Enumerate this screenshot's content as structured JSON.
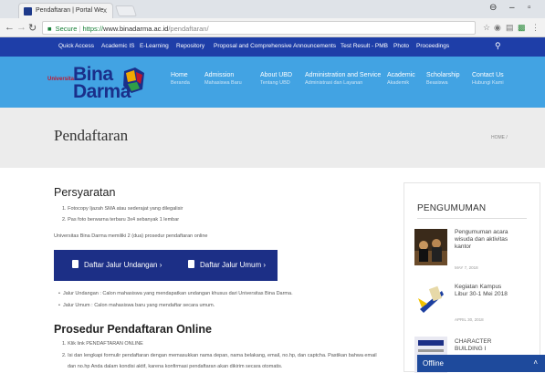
{
  "browser": {
    "tab_title": "Pendaftaran | Portal We",
    "tab_close": "x",
    "url_secure": "Secure",
    "url_protocol": "https://",
    "url_host": "www.binadarma.ac.id",
    "url_path": "/pendaftaran/",
    "win_min": "–",
    "win_max": "▫",
    "win_account": "⊖"
  },
  "topnav": {
    "items": [
      "Quick Access",
      "Academic IS",
      "E-Learning",
      "Repository",
      "Proposal and Comprehensive Announcements",
      "Test Result - PMB",
      "Photo",
      "Proceedings"
    ]
  },
  "logo": {
    "univ": "Universitas",
    "bina": "Bina",
    "darma": "Darma"
  },
  "header_menu": [
    {
      "title": "Home",
      "sub": "Beranda"
    },
    {
      "title": "Admission",
      "sub": "Mahasiswa Baru"
    },
    {
      "title": "About UBD",
      "sub": "Tentang UBD"
    },
    {
      "title": "Administration and Service",
      "sub": "Administrasi dan Layanan"
    },
    {
      "title": "Academic",
      "sub": "Akademik"
    },
    {
      "title": "Scholarship",
      "sub": "Beasiswa"
    },
    {
      "title": "Contact Us",
      "sub": "Hubungi Kami"
    }
  ],
  "page": {
    "title": "Pendaftaran",
    "breadcrumb": "HOME /"
  },
  "content": {
    "persyaratan": "Persyaratan",
    "requirements": [
      "1. Fotocopy Ijazah SMA atau sederajat yang dilegalisir",
      "2. Pas foto berwarna terbaru 3x4 sebanyak 1 lembar"
    ],
    "intro": "Universitas Bina Darma memiliki 2 (dua) prosedur pendaftaran online",
    "btn_undangan": "Daftar Jalur Undangan  ›",
    "btn_umum": "Daftar Jalur Umum  ›",
    "bullets": [
      "Jalur Undangan : Calon mahasiswa yang mendapatkan undangan khusus dari Universitas Bina Darma.",
      "Jalur Umum : Calon mahasiswa baru yang mendaftar secara umum."
    ],
    "prosedur": "Prosedur Pendaftaran Online",
    "steps": [
      "1. Klik link PENDAFTARAN ONLINE",
      "2. Isi dan lengkapi formulir pendaftaran dengan memasukkan nama depan, nama belakang, email, no.hp, dan captcha. Pastikan bahwa email",
      "dan no.hp Anda dalam kondisi aktif, karena konfirmasi pendaftaran akan dikirim secara otomatis."
    ]
  },
  "sidebar": {
    "heading": "PENGUMUMAN",
    "news": [
      {
        "title": "Pengumuman acara wisuda dan aktivitas kantor",
        "date": "MAY 7, 2018"
      },
      {
        "title": "Kegiatan Kampus Libur 30-1 Mei 2018",
        "date": "APRIL 30, 2018"
      },
      {
        "title": "CHARACTER BUILDING I",
        "date": ""
      }
    ]
  },
  "chat": {
    "label": "Offline",
    "caret": "˄"
  }
}
